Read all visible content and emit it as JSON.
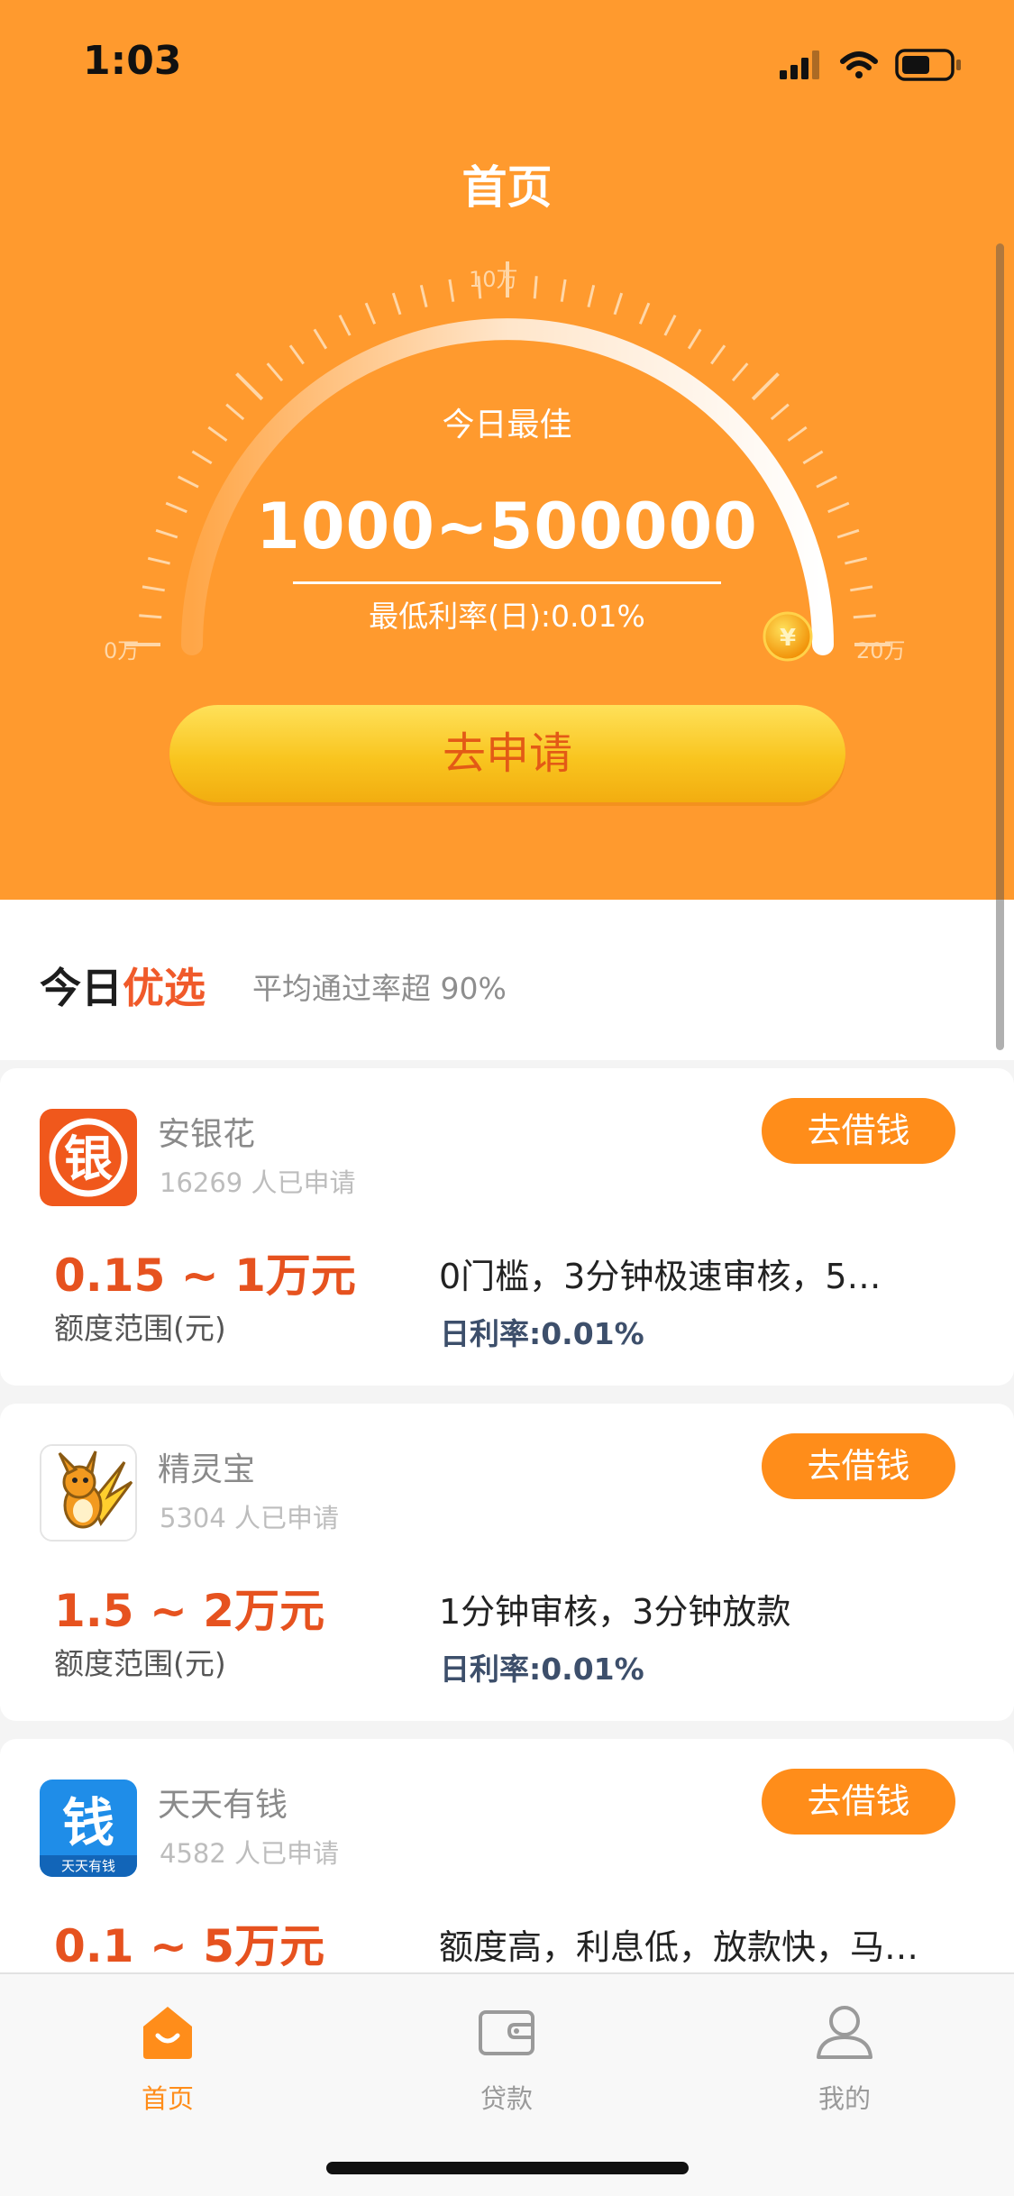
{
  "status_bar": {
    "time": "1:03"
  },
  "header": {
    "title": "首页"
  },
  "gauge": {
    "subtitle": "今日最佳",
    "range": "1000~500000",
    "rate": "最低利率(日):0.01%",
    "ticks": {
      "min": "0万",
      "mid": "10万",
      "max": "20万"
    },
    "coin_symbol": "¥"
  },
  "apply_button_label": "去申请",
  "section": {
    "title_plain": "今日",
    "title_highlight": "优选",
    "subtitle": "平均通过率超 90%"
  },
  "cards": [
    {
      "name": "安银花",
      "count": "16269 人已申请",
      "button": "去借钱",
      "amount": "0.15 ~ 1万元",
      "amount_label": "额度范围(元)",
      "desc": "0门槛，3分钟极速审核，5…",
      "rate": "日利率:0.01%",
      "logo_char": "银"
    },
    {
      "name": "精灵宝",
      "count": "5304 人已申请",
      "button": "去借钱",
      "amount": "1.5 ~ 2万元",
      "amount_label": "额度范围(元)",
      "desc": "1分钟审核，3分钟放款",
      "rate": "日利率:0.01%"
    },
    {
      "name": "天天有钱",
      "count": "4582 人已申请",
      "button": "去借钱",
      "amount": "0.1 ~ 5万元",
      "desc": "额度高，利息低，放款快，马…",
      "logo_char": "钱",
      "logo_caption": "天天有钱"
    }
  ],
  "tabs": [
    {
      "label": "首页",
      "icon": "home-icon",
      "active": true
    },
    {
      "label": "贷款",
      "icon": "wallet-icon",
      "active": false
    },
    {
      "label": "我的",
      "icon": "profile-icon",
      "active": false
    }
  ],
  "colors": {
    "primary": "#ff9a2e",
    "accent": "#e6521f",
    "button": "#ff8d1a"
  }
}
